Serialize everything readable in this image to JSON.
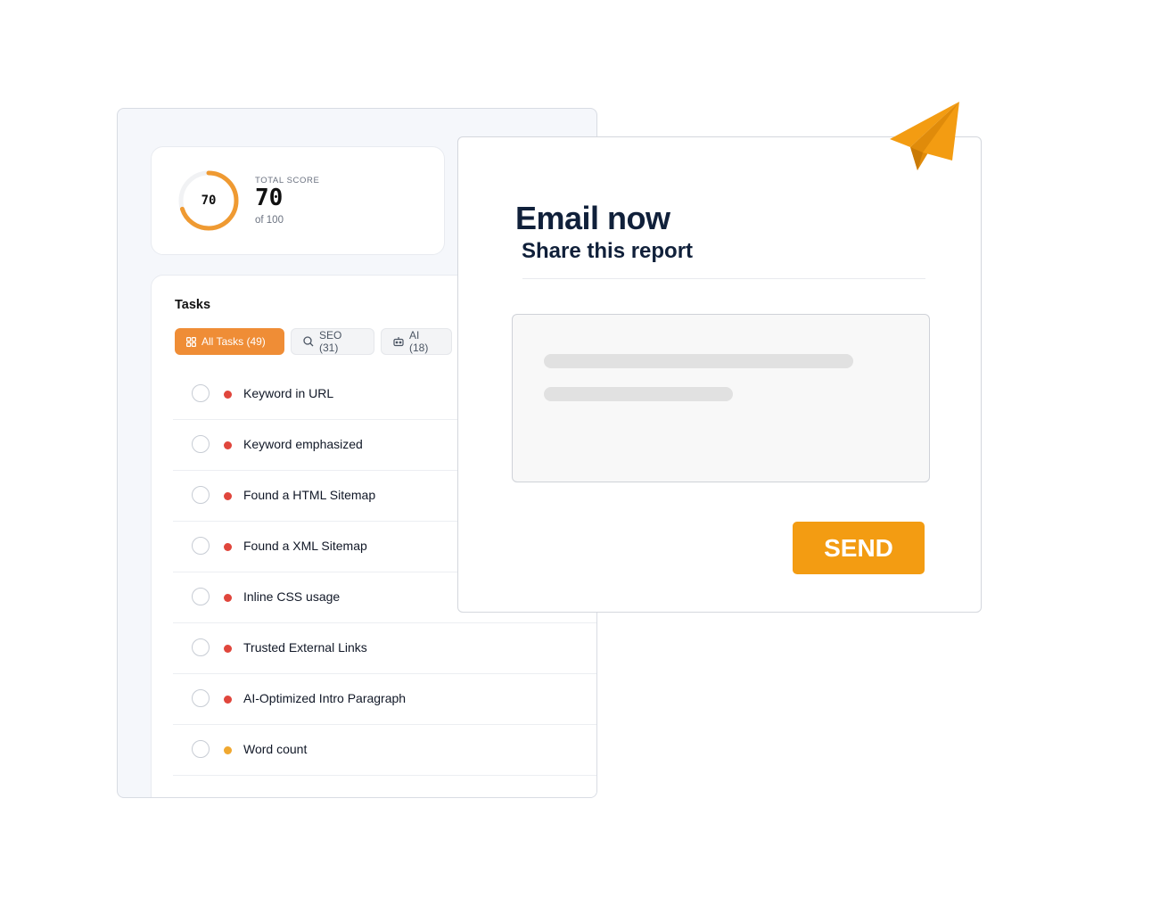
{
  "score": {
    "label": "TOTAL SCORE",
    "gauge_value": "70",
    "value": "70",
    "of": "of 100",
    "fraction": 0.7,
    "color": "#ef9a32"
  },
  "tasks": {
    "title": "Tasks",
    "filters": [
      {
        "label": "All Tasks (49)",
        "icon": "grid-icon",
        "active": true
      },
      {
        "label": "SEO (31)",
        "icon": "search-icon",
        "active": false
      },
      {
        "label": "AI (18)",
        "icon": "robot-icon",
        "active": false
      }
    ],
    "items": [
      {
        "label": "Keyword in URL",
        "severity_color": "#e0463c"
      },
      {
        "label": "Keyword emphasized",
        "severity_color": "#e0463c"
      },
      {
        "label": "Found a HTML Sitemap",
        "severity_color": "#e0463c"
      },
      {
        "label": "Found a XML Sitemap",
        "severity_color": "#e0463c"
      },
      {
        "label": "Inline CSS usage",
        "severity_color": "#e0463c"
      },
      {
        "label": "Trusted External Links",
        "severity_color": "#e0463c"
      },
      {
        "label": "AI-Optimized Intro Paragraph",
        "severity_color": "#e0463c"
      },
      {
        "label": "Word count",
        "severity_color": "#f0a830"
      }
    ]
  },
  "email": {
    "title": "Email now",
    "subtitle": "Share this report",
    "send_label": "SEND",
    "accent": "#f39c12",
    "icon": "paper-plane-icon"
  }
}
